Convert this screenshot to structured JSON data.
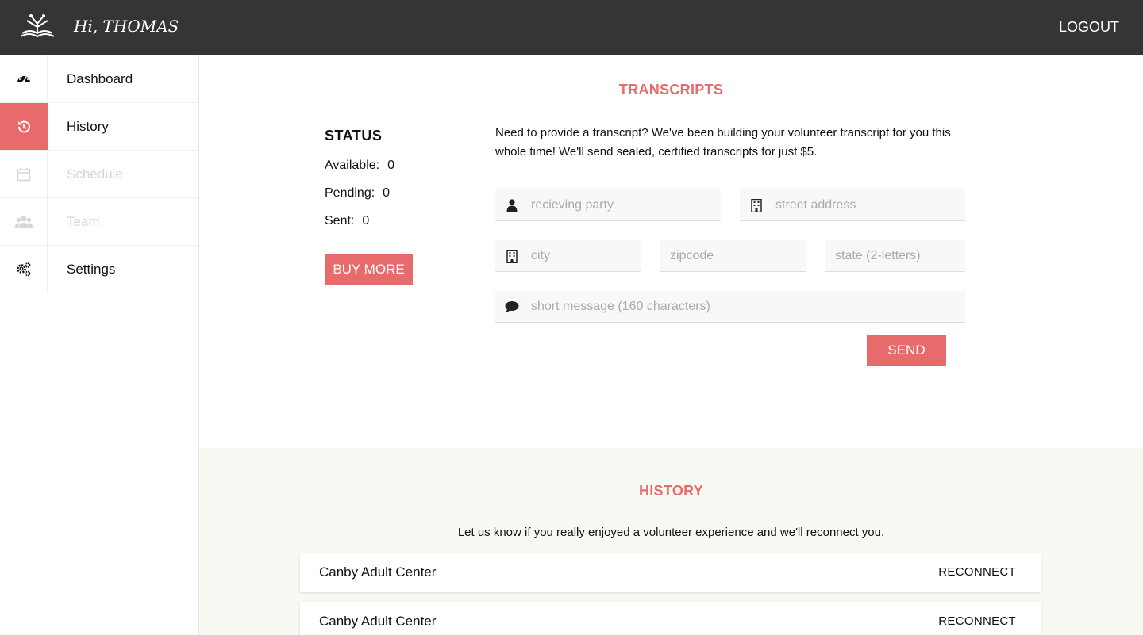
{
  "header": {
    "logo": "open-book-logo",
    "greeting": "Hi, THOMAS",
    "logout_label": "LOGOUT"
  },
  "sidebar": {
    "items": [
      {
        "label": "Dashboard",
        "icon": "dashboard-icon",
        "state": "normal"
      },
      {
        "label": "History",
        "icon": "history-icon",
        "state": "active"
      },
      {
        "label": "Schedule",
        "icon": "calendar-icon",
        "state": "disabled"
      },
      {
        "label": "Team",
        "icon": "team-icon",
        "state": "disabled"
      },
      {
        "label": "Settings",
        "icon": "gears-icon",
        "state": "normal"
      }
    ]
  },
  "transcripts": {
    "title": "TRANSCRIPTS",
    "status": {
      "title": "STATUS",
      "available_label": "Available:",
      "available_value": "0",
      "pending_label": "Pending:",
      "pending_value": "0",
      "sent_label": "Sent:",
      "sent_value": "0"
    },
    "buy_more_label": "BUY MORE",
    "intro": "Need to provide a transcript? We've been building your volunteer transcript for you this whole time! We'll send sealed, certified transcripts for just $5.",
    "fields": {
      "receiving_party": "recieving party",
      "street_address": "street address",
      "city": "city",
      "zipcode": "zipcode",
      "state": "state (2-letters)",
      "message": "short message (160 characters)"
    },
    "send_label": "SEND"
  },
  "history": {
    "title": "HISTORY",
    "subtitle": "Let us know if you really enjoyed a volunteer experience and we'll reconnect you.",
    "items": [
      {
        "name": "Canby Adult Center",
        "action": "RECONNECT"
      },
      {
        "name": "Canby Adult Center",
        "action": "RECONNECT"
      }
    ]
  },
  "colors": {
    "accent": "#e86b6b",
    "topbar": "#353535",
    "history_bg": "#f9f9f4"
  }
}
